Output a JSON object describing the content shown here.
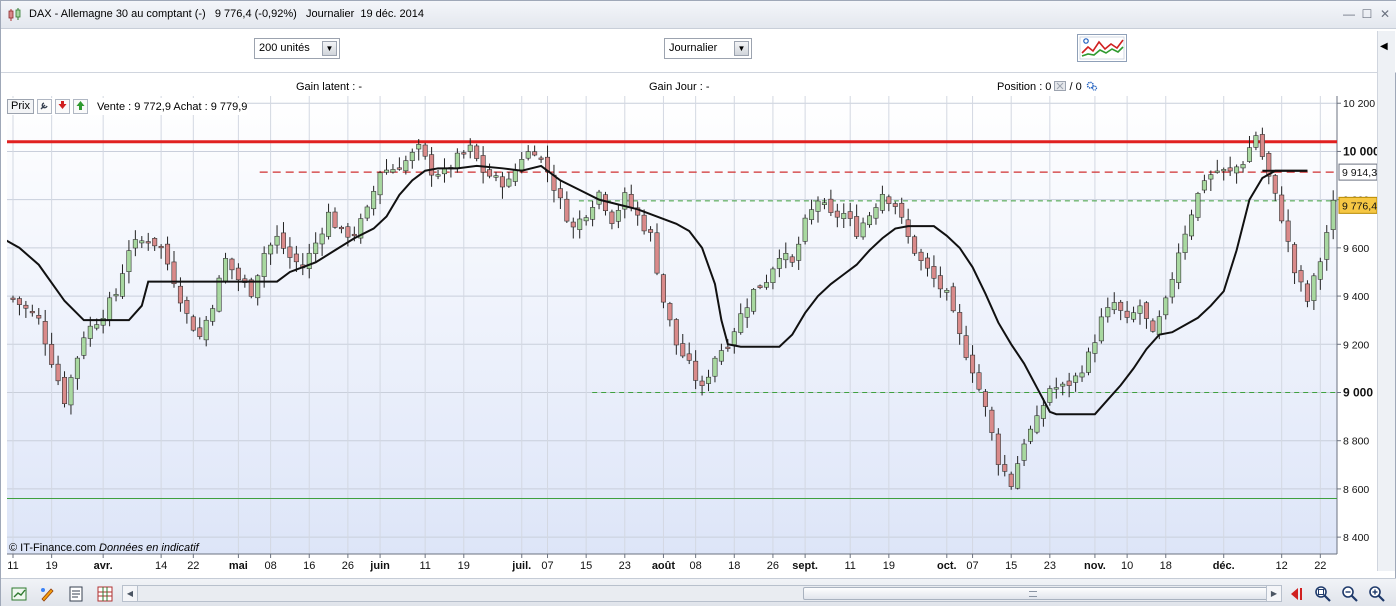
{
  "window": {
    "title": "DAX - Allemagne 30 au comptant (-)   9 776,4 (-0,92%)   Journalier  19 déc. 2014",
    "minimize": "—",
    "restore": "☐",
    "close": "✕"
  },
  "toolbar": {
    "units_select": "200 unités",
    "period_select": "Journalier"
  },
  "infobar": {
    "gain_latent": "Gain latent : -",
    "gain_jour": "Gain Jour : -",
    "position_label": "Position : 0",
    "position_sep": " / 0"
  },
  "legend": {
    "prix": "Prix",
    "bid_ask": "Vente : 9 772,9 Achat : 9 779,9"
  },
  "credit": {
    "owner": "© IT-Finance.com",
    "note": "Données en indicatif"
  },
  "icons": {
    "app": "candlestick-icon",
    "settings": "wrench-icon",
    "down": "arrow-down-icon",
    "up": "arrow-up-icon",
    "indicators": "indicator-chart-icon",
    "zoom_in": "zoom-in-icon",
    "zoom_out": "zoom-out-icon"
  },
  "colors": {
    "bull": "#a8d8a0",
    "bear": "#d98a8a",
    "resistance": "#e02020",
    "level_dashed_red": "#d03030",
    "level_dashed_green": "#3fa03f",
    "support": "#3fa03f",
    "ma": "#111111",
    "bg_top": "#ffffff",
    "bg_bottom": "#dde5f8"
  },
  "chart_data": {
    "type": "candlestick",
    "y_ticks": [
      "10 200",
      "10 000",
      "9 800",
      "9 600",
      "9 400",
      "9 200",
      "9 000",
      "8 800",
      "8 600",
      "8 400"
    ],
    "y_tick_values": [
      10200,
      10000,
      9800,
      9600,
      9400,
      9200,
      9000,
      8800,
      8600,
      8400
    ],
    "ylim": [
      8330,
      10230
    ],
    "x_labels": [
      {
        "t": "11",
        "i": 0,
        "b": false
      },
      {
        "t": "19",
        "i": 6,
        "b": false
      },
      {
        "t": "avr.",
        "i": 14,
        "b": true
      },
      {
        "t": "14",
        "i": 23,
        "b": false
      },
      {
        "t": "22",
        "i": 28,
        "b": false
      },
      {
        "t": "mai",
        "i": 35,
        "b": true
      },
      {
        "t": "08",
        "i": 40,
        "b": false
      },
      {
        "t": "16",
        "i": 46,
        "b": false
      },
      {
        "t": "26",
        "i": 52,
        "b": false
      },
      {
        "t": "juin",
        "i": 57,
        "b": true
      },
      {
        "t": "11",
        "i": 64,
        "b": false
      },
      {
        "t": "19",
        "i": 70,
        "b": false
      },
      {
        "t": "juil.",
        "i": 79,
        "b": true
      },
      {
        "t": "07",
        "i": 83,
        "b": false
      },
      {
        "t": "15",
        "i": 89,
        "b": false
      },
      {
        "t": "23",
        "i": 95,
        "b": false
      },
      {
        "t": "août",
        "i": 101,
        "b": true
      },
      {
        "t": "08",
        "i": 106,
        "b": false
      },
      {
        "t": "18",
        "i": 112,
        "b": false
      },
      {
        "t": "26",
        "i": 118,
        "b": false
      },
      {
        "t": "sept.",
        "i": 123,
        "b": true
      },
      {
        "t": "11",
        "i": 130,
        "b": false
      },
      {
        "t": "19",
        "i": 136,
        "b": false
      },
      {
        "t": "oct.",
        "i": 145,
        "b": true
      },
      {
        "t": "07",
        "i": 149,
        "b": false
      },
      {
        "t": "15",
        "i": 155,
        "b": false
      },
      {
        "t": "23",
        "i": 161,
        "b": false
      },
      {
        "t": "nov.",
        "i": 168,
        "b": true
      },
      {
        "t": "10",
        "i": 173,
        "b": false
      },
      {
        "t": "18",
        "i": 179,
        "b": false
      },
      {
        "t": "déc.",
        "i": 188,
        "b": true
      },
      {
        "t": "12",
        "i": 197,
        "b": false
      },
      {
        "t": "22",
        "i": 203,
        "b": false
      }
    ],
    "close_path": [
      [
        0,
        9390
      ],
      [
        4,
        9300
      ],
      [
        8,
        8970
      ],
      [
        11,
        9240
      ],
      [
        14,
        9330
      ],
      [
        16,
        9410
      ],
      [
        18,
        9600
      ],
      [
        21,
        9640
      ],
      [
        23,
        9600
      ],
      [
        25,
        9470
      ],
      [
        27,
        9320
      ],
      [
        29,
        9230
      ],
      [
        31,
        9370
      ],
      [
        33,
        9550
      ],
      [
        35,
        9470
      ],
      [
        37,
        9420
      ],
      [
        39,
        9580
      ],
      [
        41,
        9640
      ],
      [
        43,
        9560
      ],
      [
        45,
        9520
      ],
      [
        47,
        9620
      ],
      [
        49,
        9740
      ],
      [
        51,
        9660
      ],
      [
        53,
        9660
      ],
      [
        55,
        9750
      ],
      [
        57,
        9920
      ],
      [
        59,
        9930
      ],
      [
        61,
        9960
      ],
      [
        63,
        10010
      ],
      [
        65,
        9920
      ],
      [
        67,
        9910
      ],
      [
        69,
        9970
      ],
      [
        71,
        10010
      ],
      [
        73,
        9920
      ],
      [
        75,
        9880
      ],
      [
        77,
        9870
      ],
      [
        79,
        9980
      ],
      [
        81,
        10010
      ],
      [
        83,
        9920
      ],
      [
        85,
        9790
      ],
      [
        87,
        9680
      ],
      [
        89,
        9750
      ],
      [
        91,
        9830
      ],
      [
        93,
        9720
      ],
      [
        95,
        9810
      ],
      [
        97,
        9730
      ],
      [
        99,
        9650
      ],
      [
        101,
        9380
      ],
      [
        103,
        9200
      ],
      [
        105,
        9110
      ],
      [
        107,
        9010
      ],
      [
        109,
        9150
      ],
      [
        111,
        9210
      ],
      [
        113,
        9320
      ],
      [
        115,
        9420
      ],
      [
        117,
        9470
      ],
      [
        119,
        9580
      ],
      [
        121,
        9530
      ],
      [
        123,
        9700
      ],
      [
        125,
        9800
      ],
      [
        127,
        9730
      ],
      [
        129,
        9740
      ],
      [
        131,
        9670
      ],
      [
        133,
        9740
      ],
      [
        135,
        9830
      ],
      [
        137,
        9780
      ],
      [
        139,
        9640
      ],
      [
        141,
        9540
      ],
      [
        143,
        9470
      ],
      [
        145,
        9400
      ],
      [
        147,
        9230
      ],
      [
        149,
        9100
      ],
      [
        151,
        8930
      ],
      [
        153,
        8720
      ],
      [
        155,
        8620
      ],
      [
        157,
        8800
      ],
      [
        159,
        8880
      ],
      [
        161,
        9020
      ],
      [
        163,
        9020
      ],
      [
        165,
        9060
      ],
      [
        167,
        9150
      ],
      [
        169,
        9300
      ],
      [
        171,
        9370
      ],
      [
        173,
        9290
      ],
      [
        175,
        9360
      ],
      [
        177,
        9230
      ],
      [
        179,
        9370
      ],
      [
        181,
        9590
      ],
      [
        183,
        9750
      ],
      [
        185,
        9890
      ],
      [
        187,
        9920
      ],
      [
        189,
        9910
      ],
      [
        191,
        9960
      ],
      [
        193,
        10070
      ],
      [
        195,
        9890
      ],
      [
        197,
        9730
      ],
      [
        199,
        9500
      ],
      [
        201,
        9380
      ],
      [
        203,
        9550
      ],
      [
        205,
        9780
      ]
    ],
    "ma_path": [
      [
        -1,
        9630
      ],
      [
        1,
        9600
      ],
      [
        4,
        9530
      ],
      [
        8,
        9380
      ],
      [
        11,
        9300
      ],
      [
        14,
        9300
      ],
      [
        18,
        9300
      ],
      [
        20,
        9360
      ],
      [
        21,
        9460
      ],
      [
        23,
        9460
      ],
      [
        30,
        9460
      ],
      [
        34,
        9460
      ],
      [
        38,
        9460
      ],
      [
        41,
        9460
      ],
      [
        43,
        9500
      ],
      [
        47,
        9540
      ],
      [
        50,
        9590
      ],
      [
        53,
        9640
      ],
      [
        56,
        9680
      ],
      [
        58,
        9730
      ],
      [
        60,
        9820
      ],
      [
        62,
        9880
      ],
      [
        64,
        9920
      ],
      [
        66,
        9930
      ],
      [
        69,
        9930
      ],
      [
        72,
        9940
      ],
      [
        76,
        9930
      ],
      [
        79,
        9920
      ],
      [
        82,
        9940
      ],
      [
        85,
        9880
      ],
      [
        88,
        9840
      ],
      [
        91,
        9800
      ],
      [
        94,
        9780
      ],
      [
        97,
        9760
      ],
      [
        100,
        9730
      ],
      [
        103,
        9700
      ],
      [
        105,
        9670
      ],
      [
        107,
        9600
      ],
      [
        109,
        9450
      ],
      [
        110,
        9300
      ],
      [
        111,
        9200
      ],
      [
        113,
        9190
      ],
      [
        117,
        9190
      ],
      [
        119,
        9190
      ],
      [
        121,
        9240
      ],
      [
        123,
        9330
      ],
      [
        125,
        9400
      ],
      [
        127,
        9450
      ],
      [
        129,
        9490
      ],
      [
        131,
        9530
      ],
      [
        133,
        9590
      ],
      [
        135,
        9640
      ],
      [
        137,
        9680
      ],
      [
        139,
        9690
      ],
      [
        143,
        9690
      ],
      [
        145,
        9650
      ],
      [
        147,
        9600
      ],
      [
        149,
        9520
      ],
      [
        151,
        9410
      ],
      [
        153,
        9290
      ],
      [
        155,
        9200
      ],
      [
        157,
        9120
      ],
      [
        159,
        9020
      ],
      [
        161,
        8920
      ],
      [
        162,
        8910
      ],
      [
        165,
        8910
      ],
      [
        168,
        8910
      ],
      [
        170,
        8970
      ],
      [
        172,
        9030
      ],
      [
        174,
        9100
      ],
      [
        176,
        9180
      ],
      [
        178,
        9240
      ],
      [
        180,
        9250
      ],
      [
        182,
        9280
      ],
      [
        184,
        9310
      ],
      [
        186,
        9360
      ],
      [
        188,
        9420
      ],
      [
        190,
        9590
      ],
      [
        192,
        9800
      ],
      [
        194,
        9890
      ],
      [
        196,
        9920
      ],
      [
        201,
        9920
      ]
    ],
    "ma_lines": [
      {
        "y": 9920,
        "i0": 194,
        "i1": 201
      }
    ],
    "h_lines": [
      {
        "y": 10040,
        "x0": 0,
        "style": "solid-red"
      },
      {
        "y": 9914.3,
        "x0": 0.19,
        "style": "dash-red"
      },
      {
        "y": 9795,
        "x0": 0.43,
        "style": "dash-green"
      },
      {
        "y": 9000,
        "x0": 0.44,
        "style": "dash-green"
      },
      {
        "y": 8560,
        "x0": 0,
        "style": "solid-green"
      }
    ],
    "price_tags": [
      {
        "y": 9914.3,
        "text": "9 914,3",
        "kind": "plain"
      },
      {
        "y": 9776.4,
        "text": "9 776,4",
        "kind": "current"
      }
    ],
    "n_bars": 206
  }
}
